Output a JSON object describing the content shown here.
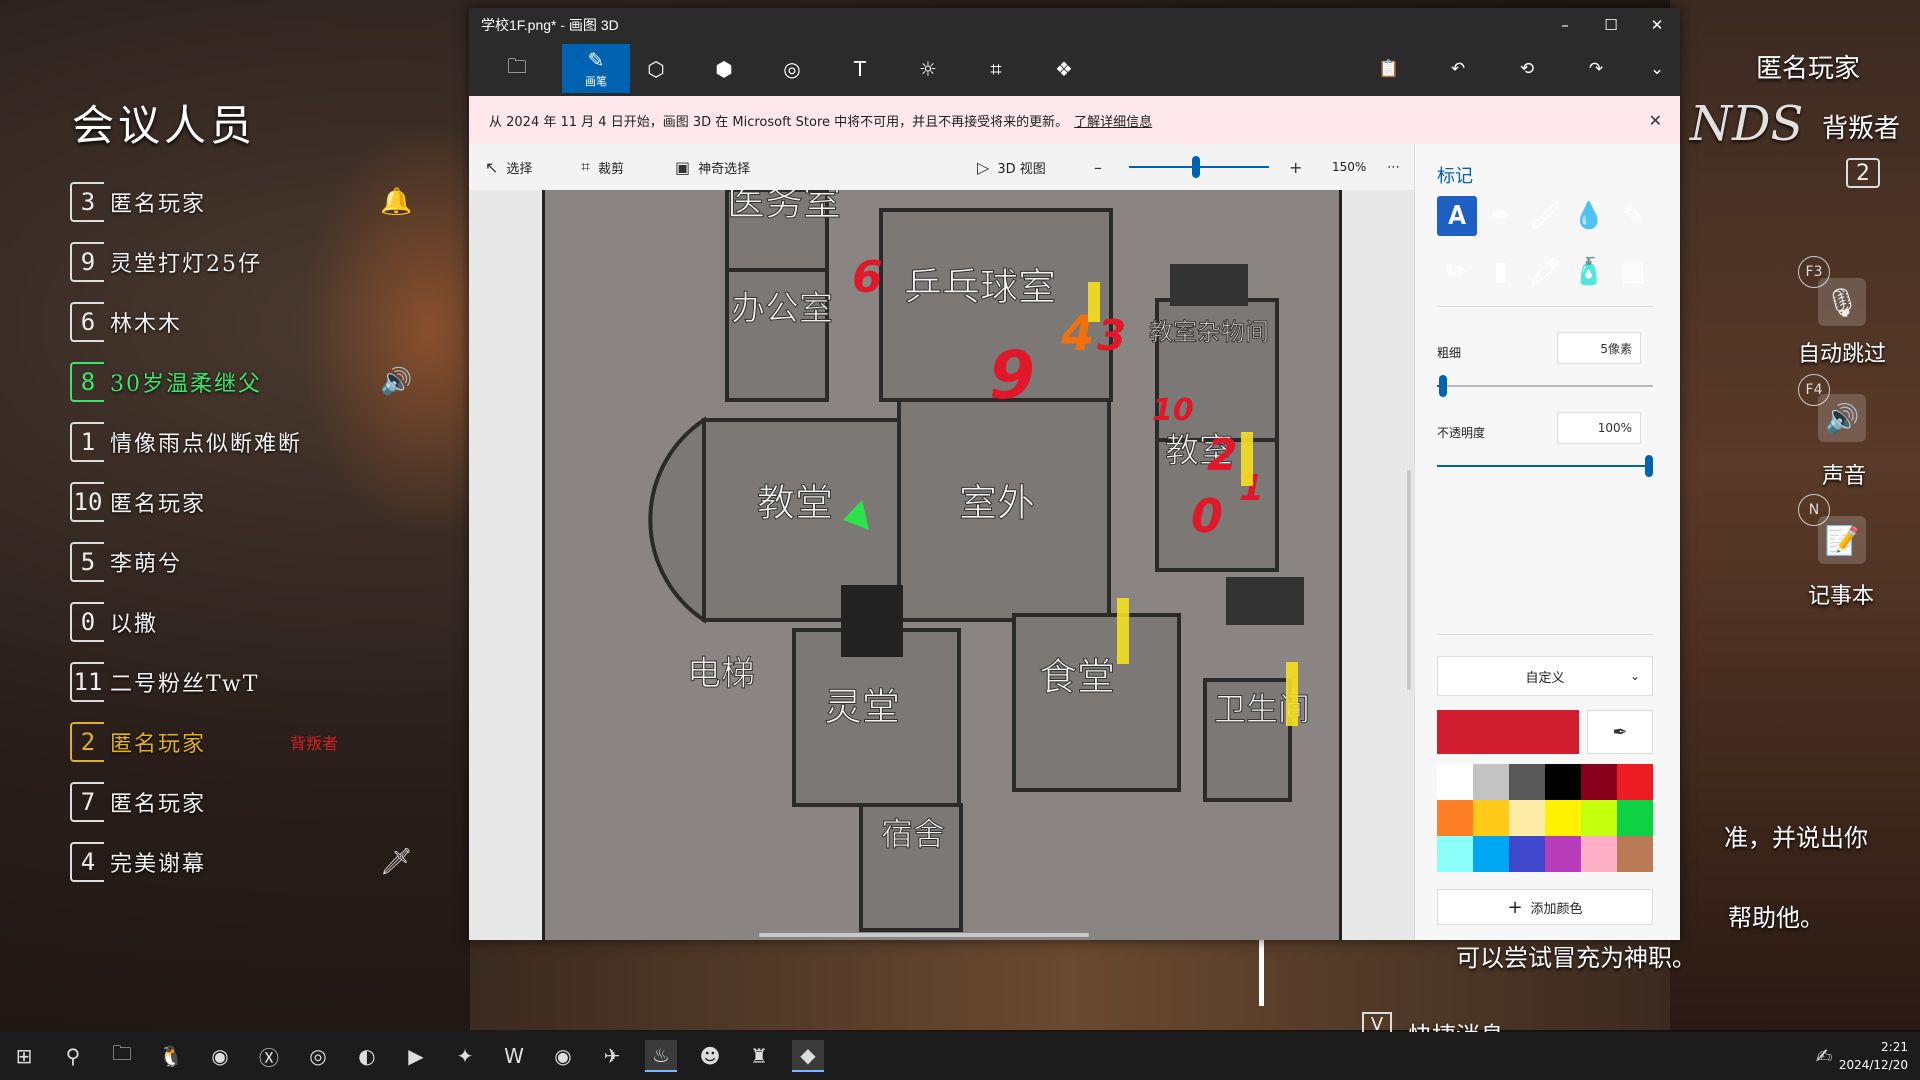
{
  "roster": {
    "title": "会议人员",
    "players": [
      {
        "num": "3",
        "name": "匿名玩家",
        "type": "normal",
        "tag": "",
        "icon": "bell-icon",
        "icon_glyph": "🔔"
      },
      {
        "num": "9",
        "name": "灵堂打灯25仔",
        "type": "normal",
        "tag": "",
        "icon": "",
        "icon_glyph": ""
      },
      {
        "num": "6",
        "name": "林木木",
        "type": "normal",
        "tag": "",
        "icon": "",
        "icon_glyph": ""
      },
      {
        "num": "8",
        "name": "30岁温柔继父",
        "type": "self",
        "tag": "",
        "icon": "speaker-icon",
        "icon_glyph": "🔊"
      },
      {
        "num": "1",
        "name": "情像雨点似断难断",
        "type": "normal",
        "tag": "",
        "icon": "",
        "icon_glyph": ""
      },
      {
        "num": "10",
        "name": "匿名玩家",
        "type": "normal",
        "tag": "",
        "icon": "",
        "icon_glyph": ""
      },
      {
        "num": "5",
        "name": "李萌兮",
        "type": "normal",
        "tag": "",
        "icon": "",
        "icon_glyph": ""
      },
      {
        "num": "0",
        "name": "以撒",
        "type": "normal",
        "tag": "",
        "icon": "",
        "icon_glyph": ""
      },
      {
        "num": "11",
        "name": "二号粉丝TwT",
        "type": "normal",
        "tag": "",
        "icon": "",
        "icon_glyph": ""
      },
      {
        "num": "2",
        "name": "匿名玩家",
        "type": "traitor",
        "tag": "背叛者",
        "icon": "",
        "icon_glyph": ""
      },
      {
        "num": "7",
        "name": "匿名玩家",
        "type": "normal",
        "tag": "",
        "icon": "",
        "icon_glyph": ""
      },
      {
        "num": "4",
        "name": "完美谢幕",
        "type": "normal",
        "tag": "",
        "icon": "knife-icon",
        "icon_glyph": "🗡"
      }
    ]
  },
  "hud": {
    "player_name": "匿名玩家",
    "role": "背叛者",
    "role_badge": "2",
    "key_f3": "F3",
    "auto_skip": "自动跳过",
    "key_f4": "F4",
    "sound": "声音",
    "key_n": "N",
    "notepad": "记事本",
    "logo_fragment": "NDS"
  },
  "chat": {
    "line1": "准，并说出你",
    "line2": "帮助他。",
    "line3": "可以尝试冒充为神职。",
    "quick_key": "V",
    "quick_label": "快捷消息"
  },
  "paint": {
    "title": "学校1F.png* - 画图 3D",
    "tools": [
      {
        "name": "folder-icon",
        "glyph": "🗀",
        "label": ""
      },
      {
        "name": "brushes-tool",
        "glyph": "✎",
        "label": "画笔"
      },
      {
        "name": "2d-shapes-tool",
        "glyph": "⬡",
        "label": ""
      },
      {
        "name": "3d-shapes-tool",
        "glyph": "⬢",
        "label": ""
      },
      {
        "name": "stickers-tool",
        "glyph": "◎",
        "label": ""
      },
      {
        "name": "text-tool",
        "glyph": "T",
        "label": ""
      },
      {
        "name": "effects-tool",
        "glyph": "☼",
        "label": ""
      },
      {
        "name": "canvas-tool",
        "glyph": "⌗",
        "label": ""
      },
      {
        "name": "3d-library-tool",
        "glyph": "❖",
        "label": ""
      }
    ],
    "right_tools": [
      {
        "name": "paste-icon",
        "glyph": "📋"
      },
      {
        "name": "undo-icon",
        "glyph": "↶"
      },
      {
        "name": "history-icon",
        "glyph": "⟲"
      },
      {
        "name": "redo-icon",
        "glyph": "↷"
      },
      {
        "name": "expand-icon",
        "glyph": "⌄"
      }
    ],
    "notice": {
      "text": "从 2024 年 11 月 4 日开始，画图 3D 在 Microsoft Store 中将不可用，并且不再接受将来的更新。",
      "link": "了解详细信息"
    },
    "canvas_bar": {
      "select": "选择",
      "crop": "裁剪",
      "magic_select": "神奇选择",
      "view_3d": "3D 视图",
      "zoom": "150%",
      "zoom_fraction": 0.48,
      "more": "⋯"
    },
    "panel": {
      "title": "标记",
      "thickness_label": "粗细",
      "thickness_value": "5像素",
      "thickness_fraction": 0.03,
      "opacity_label": "不透明度",
      "opacity_value": "100%",
      "opacity_fraction": 1.0,
      "color_mode": "自定义",
      "current_color": "#d01e30",
      "add_color": "添加颜色",
      "brushes": [
        "marker",
        "calligraphy-pen",
        "oil-brush",
        "watercolor",
        "pixel-pen",
        "pencil",
        "eraser",
        "crayon",
        "spray-can",
        "fill"
      ],
      "palette": [
        "#ffffff",
        "#c3c3c3",
        "#585858",
        "#000000",
        "#88001b",
        "#ec1c24",
        "#ff7f27",
        "#ffca18",
        "#fdeca6",
        "#fff200",
        "#c4ff0e",
        "#0ed145",
        "#8cfffb",
        "#00a8f3",
        "#3f48cc",
        "#b83dba",
        "#ffaec8",
        "#b97a56"
      ]
    }
  },
  "map": {
    "rooms": [
      "医务室",
      "办公室",
      "乒乓球室",
      "教室杂物间",
      "教堂",
      "室外",
      "教室",
      "电梯",
      "灵堂",
      "食堂",
      "卫生间",
      "宿舍"
    ],
    "annotations": [
      "6",
      "9",
      "4",
      "3",
      "10",
      "2",
      "1",
      "0"
    ]
  },
  "taskbar": {
    "time": "2:21",
    "date": "2024/12/20"
  }
}
